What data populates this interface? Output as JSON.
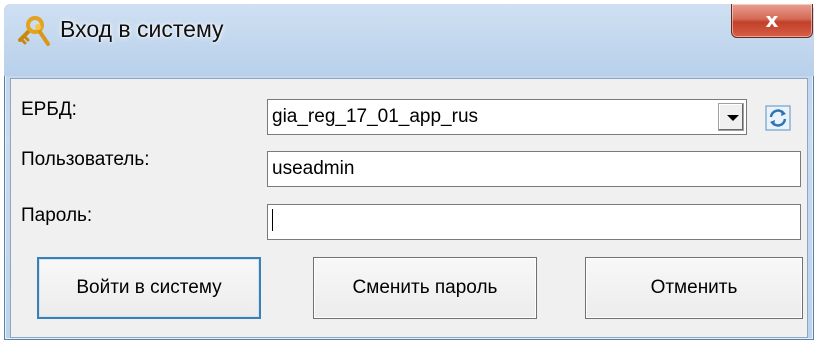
{
  "window": {
    "title": "Вход в систему",
    "close_label": "x",
    "title_icon": "keys-icon"
  },
  "form": {
    "db_label": "ЕРБД:",
    "db_value": "gia_reg_17_01_app_rus",
    "user_label": "Пользователь:",
    "user_value": "useadmin",
    "password_label": "Пароль:",
    "password_value": ""
  },
  "buttons": {
    "login": "Войти в систему",
    "change_password": "Сменить пароль",
    "cancel": "Отменить"
  },
  "colors": {
    "accent": "#3c7fb1",
    "close": "#c2402a",
    "frame": "#b9d1ea"
  }
}
